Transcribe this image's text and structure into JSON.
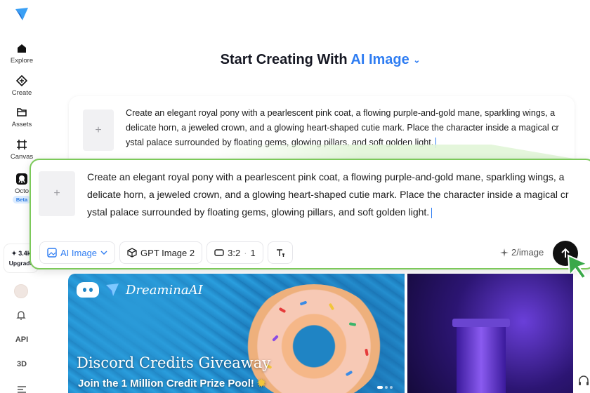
{
  "sidebar": {
    "items": [
      {
        "label": "Explore",
        "icon": "home-icon"
      },
      {
        "label": "Create",
        "icon": "create-icon"
      },
      {
        "label": "Assets",
        "icon": "folder-icon"
      },
      {
        "label": "Canvas",
        "icon": "canvas-icon"
      },
      {
        "label": "Octo",
        "icon": "octo-icon",
        "badge": "Beta"
      }
    ],
    "credits": {
      "count": "3.4k",
      "upgrade": "Upgrade"
    },
    "api_label": "API",
    "three_d_label": "3D"
  },
  "header": {
    "title_prefix": "Start Creating With",
    "title_accent": "AI Image",
    "chevron": "⌄"
  },
  "prompt": {
    "text": "Create an elegant royal pony with a pearlescent pink coat, a flowing purple-and-gold mane, sparkling wings, a delicate horn, a jeweled crown, and a glowing heart-shaped cutie mark. Place the character inside a magical crystal palace surrounded by floating gems, glowing pillars, and soft golden light.",
    "bg_lines": [
      "Create an elegant royal pony with a pearlescent pink coat, a flowing purple-and-gold mane, sparkling wings, a",
      "delicate horn, a jeweled crown, and a glowing heart-shaped cutie mark. Place the character inside a magical cr",
      "ystal palace surrounded by floating gems, glowing pillars, and soft golden light."
    ],
    "zoom_lines": [
      "Create an elegant royal pony with a pearlescent pink coat, a flowing purple-and-gold mane, sparkling wings, a",
      "delicate horn, a jeweled crown, and a glowing heart-shaped cutie mark. Place the character inside a magical cr",
      "ystal palace surrounded by floating gems, glowing pillars, and soft golden light."
    ],
    "add_symbol": "+"
  },
  "toolbar": {
    "mode_label": "AI Image",
    "model_label": "GPT Image 2",
    "ratio_label": "3:2",
    "count_label": "1",
    "cost_label": "2/image"
  },
  "banner": {
    "brand": "DreaminaAI",
    "title": "Discord Credits Giveaway",
    "subtitle": "Join the 1 Million Credit Prize Pool!"
  },
  "colors": {
    "accent": "#2f7df2",
    "highlight_border": "#7cc95a"
  }
}
